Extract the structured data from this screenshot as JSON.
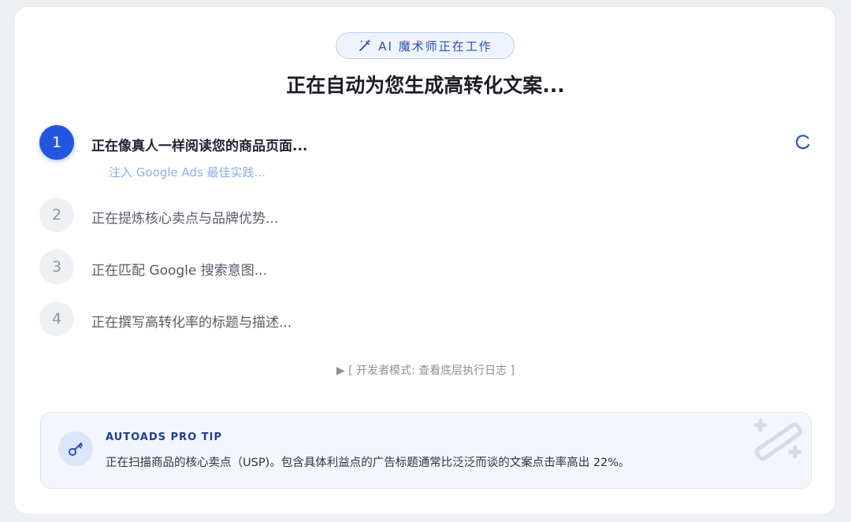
{
  "badge": {
    "label": "AI 魔术师正在工作",
    "icon": "magic-wand-icon"
  },
  "title": "正在自动为您生成高转化文案...",
  "steps": [
    {
      "number": "1",
      "label": "正在像真人一样阅读您的商品页面...",
      "status": "active",
      "substatus": "注入 Google Ads 最佳实践..."
    },
    {
      "number": "2",
      "label": "正在提炼核心卖点与品牌优势...",
      "status": "pending"
    },
    {
      "number": "3",
      "label": "正在匹配 Google 搜索意图...",
      "status": "pending"
    },
    {
      "number": "4",
      "label": "正在撰写高转化率的标题与描述...",
      "status": "pending"
    }
  ],
  "dev_log": {
    "label": "▶ [ 开发者模式: 查看底层执行日志 ]"
  },
  "tip": {
    "title": "AUTOADS PRO TIP",
    "text": "正在扫描商品的核心卖点（USP)。包含具体利益点的广告标题通常比泛泛而谈的文案点击率高出 22%。",
    "icon": "key-icon"
  },
  "colors": {
    "accent": "#2255e0",
    "badge_text": "#2f4fb2",
    "tip_background": "#f3f7fd"
  }
}
